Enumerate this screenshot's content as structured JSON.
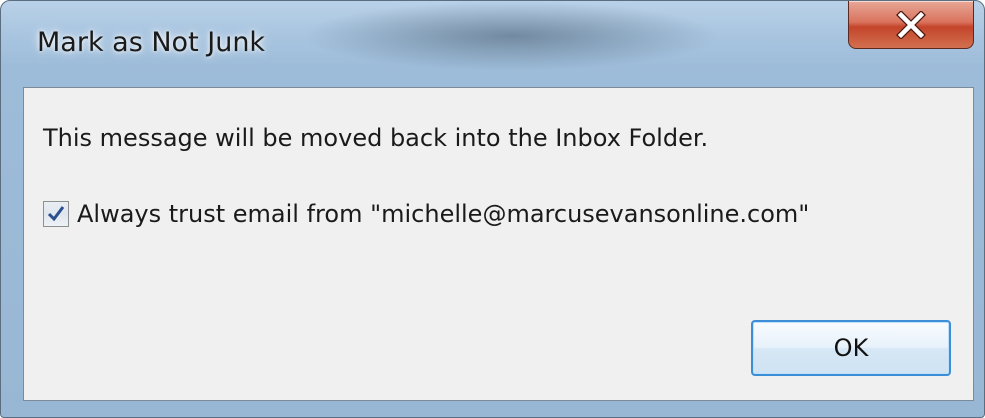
{
  "window": {
    "title": "Mark as Not Junk",
    "close_icon": "close-icon"
  },
  "dialog": {
    "message": "This message will be moved back into the Inbox Folder.",
    "checkbox": {
      "label": "Always trust email from \"michelle@marcusevansonline.com\"",
      "checked": true
    },
    "ok_label": "OK"
  },
  "colors": {
    "titlebar": "#a9c5e0",
    "close_button": "#c4452b",
    "client_background": "#f0f0f0",
    "ok_button_border": "#3c8fd6",
    "checkmark": "#2a4f8f"
  }
}
